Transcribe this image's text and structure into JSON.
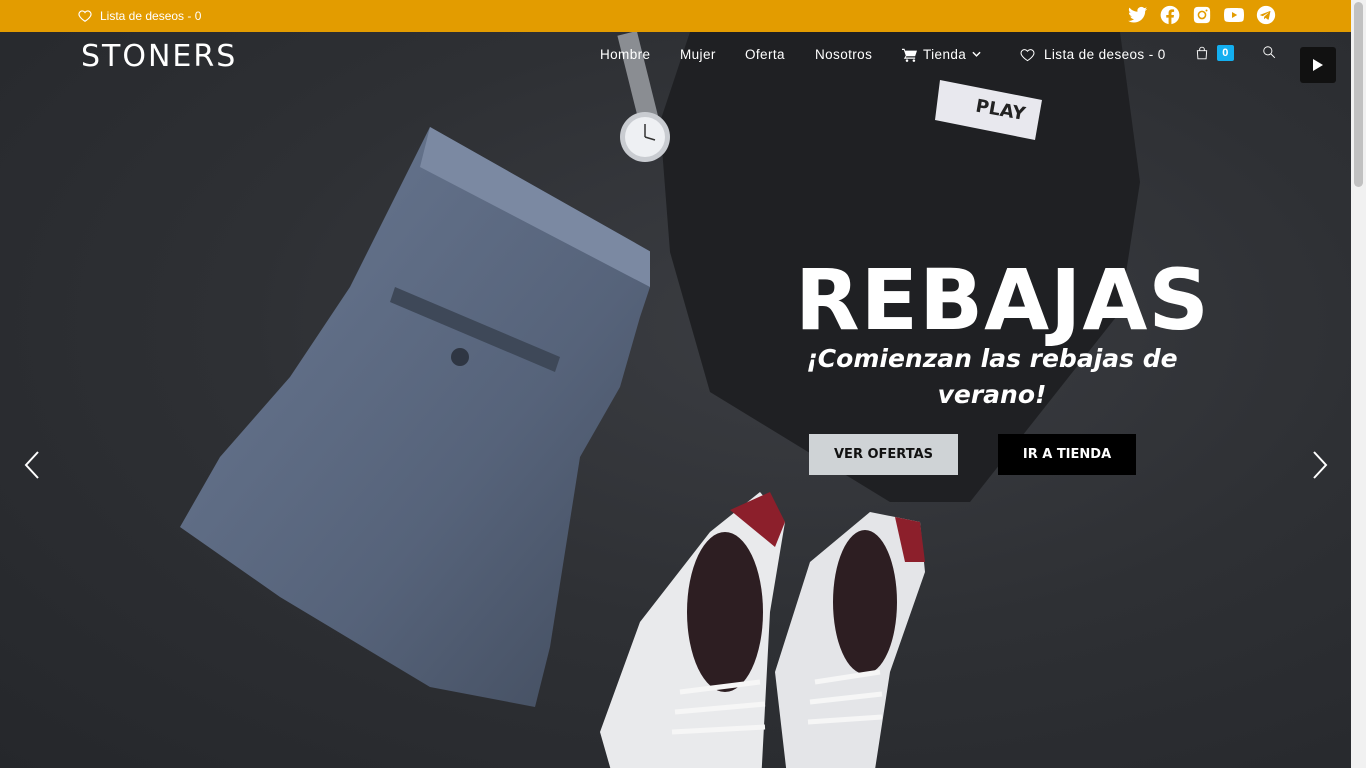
{
  "topbar": {
    "wishlist_label": "Lista de deseos - 0",
    "bg_color": "#e39c00",
    "socials": [
      "twitter-icon",
      "facebook-icon",
      "instagram-icon",
      "youtube-icon",
      "telegram-icon"
    ]
  },
  "header": {
    "logo": "STONERS",
    "nav": {
      "hombre": "Hombre",
      "mujer": "Mujer",
      "oferta": "Oferta",
      "nosotros": "Nosotros",
      "tienda": "Tienda",
      "wishlist": "Lista de deseos - 0",
      "cart_count": "0"
    }
  },
  "hero": {
    "title": "REBAJAS",
    "subtitle": "¡Comienzan las rebajas de verano!",
    "primary_button": "VER OFERTAS",
    "secondary_button": "IR A TIENDA",
    "shirt_tag_text": "PLAY"
  },
  "colors": {
    "accent": "#e39c00",
    "cart_badge": "#13aff0"
  }
}
